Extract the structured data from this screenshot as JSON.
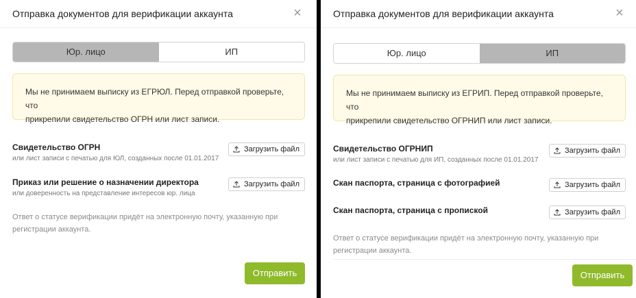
{
  "left": {
    "title": "Отправка документов для верификации аккаунта",
    "close": "×",
    "tabs": [
      {
        "label": "Юр. лицо",
        "active": true
      },
      {
        "label": "ИП",
        "active": false
      }
    ],
    "notice_line1": "Мы не принимаем выписку из ЕГРЮЛ. Перед отправкой проверьте, что",
    "notice_line2": "прикрепили свидетельство ОГРН или лист записи.",
    "docs": [
      {
        "title": "Свидетельство ОГРН",
        "subtitle": "или лист записи с печатью для ЮЛ, созданных после 01.01.2017",
        "upload": "Загрузить файл"
      },
      {
        "title": "Приказ или решение о назначении директора",
        "subtitle": "или доверенность на представление интересов юр. лица",
        "upload": "Загрузить файл"
      }
    ],
    "footer_line1": "Ответ о статусе верификации придёт на электронную почту, указанную при",
    "footer_line2": "регистрации аккаунта.",
    "submit": "Отправить"
  },
  "right": {
    "title": "Отправка документов для верификации аккаунта",
    "close": "×",
    "tabs": [
      {
        "label": "Юр. лицо",
        "active": false
      },
      {
        "label": "ИП",
        "active": true
      }
    ],
    "notice_line1": "Мы не принимаем выписку из ЕГРИП. Перед отправкой проверьте, что",
    "notice_line2": "прикрепили свидетельство ОГРНИП или лист записи.",
    "docs": [
      {
        "title": "Свидетельство ОГРНИП",
        "subtitle": "или лист записи с печатью для ИП, созданных после 01.01.2017",
        "upload": "Загрузить файл"
      },
      {
        "title": "Скан паспорта, страница с фотографией",
        "subtitle": "",
        "upload": "Загрузить файл"
      },
      {
        "title": "Скан паспорта, страница с пропиской",
        "subtitle": "",
        "upload": "Загрузить файл"
      }
    ],
    "footer_line1": "Ответ о статусе верификации придёт на электронную почту, указанную при",
    "footer_line2": "регистрации аккаунта.",
    "submit": "Отправить"
  },
  "icons": {
    "close": "close-icon",
    "upload": "upload-icon"
  },
  "colors": {
    "accent": "#8fba2c",
    "tab_active": "#b6b6b6",
    "notice_bg": "#fffbe8",
    "notice_border": "#f1e7a8"
  }
}
